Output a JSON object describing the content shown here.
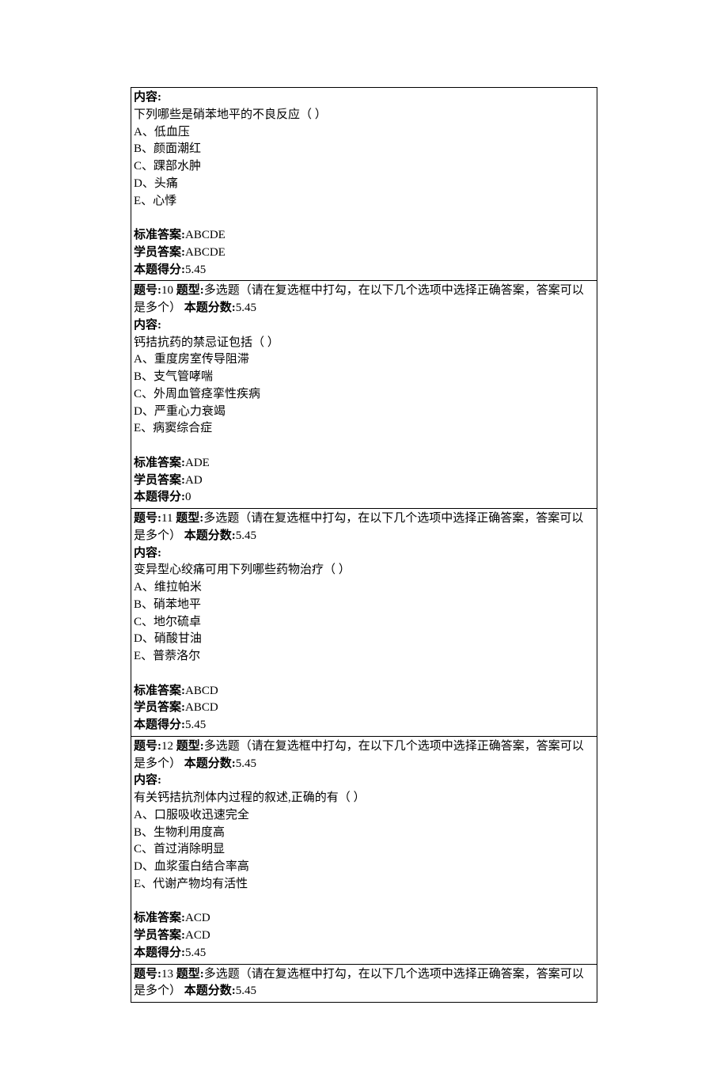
{
  "labels": {
    "content": "内容:",
    "standard_answer": "标准答案:",
    "student_answer": "学员答案:",
    "score_obtained": "本题得分:",
    "q_no": "题号:",
    "q_type": "题型:",
    "q_points": "本题分数:"
  },
  "questions": [
    {
      "header_visible": false,
      "content": {
        "stem": "下列哪些是硝苯地平的不良反应（ ）",
        "options": [
          "A、低血压",
          "B、颜面潮红",
          "C、踝部水肿",
          "D、头痛",
          "E、心悸"
        ]
      },
      "standard_answer": "ABCDE",
      "student_answer": "ABCDE",
      "score_obtained": "5.45"
    },
    {
      "header_visible": true,
      "number": "10",
      "type": "多选题（请在复选框中打勾，在以下几个选项中选择正确答案，答案可以是多个）",
      "points": "5.45",
      "content": {
        "stem": "钙拮抗药的禁忌证包括（ ）",
        "options": [
          "A、重度房室传导阻滞",
          "B、支气管哮喘",
          "C、外周血管痉挛性疾病",
          "D、严重心力衰竭",
          "E、病窦综合症"
        ]
      },
      "standard_answer": "ADE",
      "student_answer": "AD",
      "score_obtained": "0"
    },
    {
      "header_visible": true,
      "number": "11",
      "type": "多选题（请在复选框中打勾，在以下几个选项中选择正确答案，答案可以是多个）",
      "points": "5.45",
      "content": {
        "stem": "变异型心绞痛可用下列哪些药物治疗（ ）",
        "options": [
          "A、维拉帕米",
          "B、硝苯地平",
          "C、地尔硫卓",
          "D、硝酸甘油",
          "E、普萘洛尔"
        ]
      },
      "standard_answer": "ABCD",
      "student_answer": "ABCD",
      "score_obtained": "5.45"
    },
    {
      "header_visible": true,
      "number": "12",
      "type": "多选题（请在复选框中打勾，在以下几个选项中选择正确答案，答案可以是多个）",
      "points": "5.45",
      "content": {
        "stem": "有关钙拮抗剂体内过程的叙述,正确的有（ ）",
        "options": [
          "A、口服吸收迅速完全",
          "B、生物利用度高",
          "C、首过消除明显",
          "D、血浆蛋白结合率高",
          "E、代谢产物均有活性"
        ]
      },
      "standard_answer": "ACD",
      "student_answer": "ACD",
      "score_obtained": "5.45"
    },
    {
      "header_visible": true,
      "content_visible": false,
      "number": "13",
      "type": "多选题（请在复选框中打勾，在以下几个选项中选择正确答案，答案可以是多个）",
      "points": "5.45"
    }
  ]
}
